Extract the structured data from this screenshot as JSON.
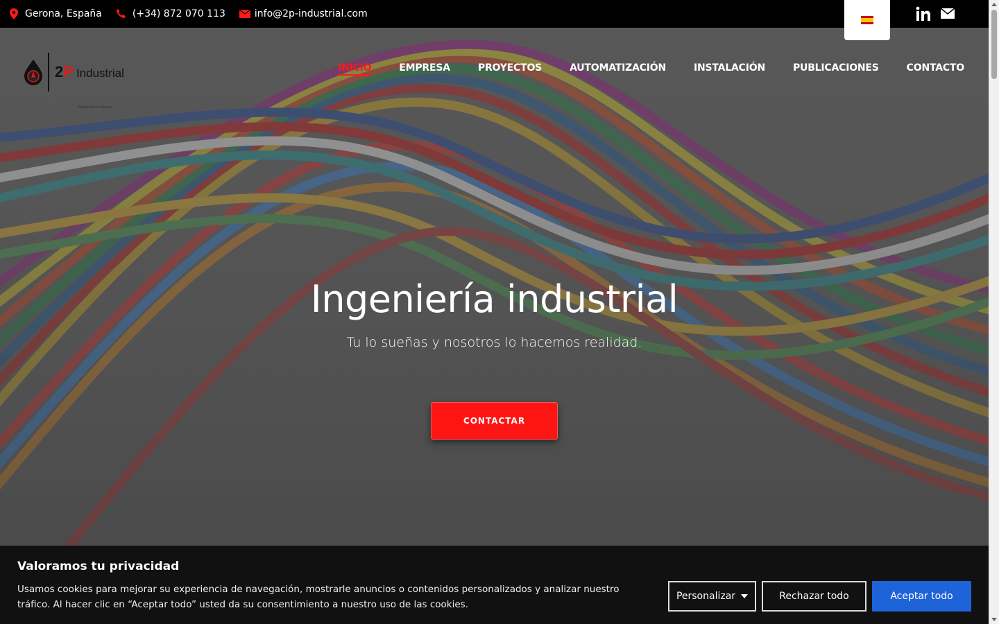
{
  "topbar": {
    "location": "Gerona, España",
    "phone": "(+34) 872 070 113",
    "email": "info@2p-industrial.com",
    "language": "es",
    "social": [
      "linkedin-icon",
      "mail-icon"
    ]
  },
  "logo": {
    "number": "2",
    "letter": "P",
    "name": "Industrial",
    "tagline": "Adapted to Industry"
  },
  "nav": {
    "items": [
      {
        "label": "INICIO",
        "active": true
      },
      {
        "label": "EMPRESA"
      },
      {
        "label": "PROYECTOS"
      },
      {
        "label": "AUTOMATIZACIÓN"
      },
      {
        "label": "INSTALACIÓN"
      },
      {
        "label": "PUBLICACIONES"
      },
      {
        "label": "CONTACTO"
      }
    ]
  },
  "hero": {
    "title": "Ingeniería industrial",
    "subtitle": "Tu lo sueñas y nosotros lo hacemos realidad.",
    "cta": "CONTACTAR"
  },
  "cookie": {
    "title": "Valoramos tu privacidad",
    "text": "Usamos cookies para mejorar su experiencia de navegación, mostrarle anuncios o contenidos personalizados y analizar nuestro tráfico. Al hacer clic en “Aceptar todo” usted da su consentimiento a nuestro uso de las cookies.",
    "customize": "Personalizar",
    "reject": "Rechazar todo",
    "accept": "Aceptar todo"
  },
  "colors": {
    "accent": "#ff1414",
    "accept_button": "#1e63d8",
    "topbar": "#000000"
  }
}
